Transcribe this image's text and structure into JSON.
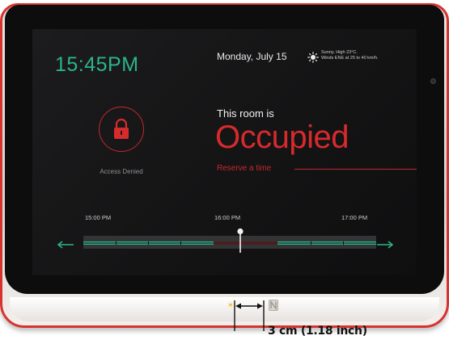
{
  "screen": {
    "clock": "15:45PM",
    "date": "Monday, July 15",
    "weather": {
      "icon": "sun-icon",
      "line1": "Sunny. High 23°C.",
      "line2": "Winds ENE at 25 to 40 km/h."
    },
    "access": {
      "icon": "lock-icon",
      "label": "Access Denied"
    },
    "room": {
      "heading": "This room is",
      "status": "Occupied",
      "reserve_link": "Reserve a time"
    },
    "timeline": {
      "labels": [
        "15:00 PM",
        "16:00 PM",
        "17:00 PM"
      ],
      "prev_icon": "arrow-left-icon",
      "next_icon": "arrow-right-icon"
    }
  },
  "device": {
    "nfc_icon": "nfc-icon",
    "annotation": "3 cm (1.18 inch)"
  },
  "colors": {
    "accent_green": "#2bb58a",
    "accent_red": "#d72a2d",
    "frame_red": "#d8322e",
    "screen_bg": "#141415"
  }
}
